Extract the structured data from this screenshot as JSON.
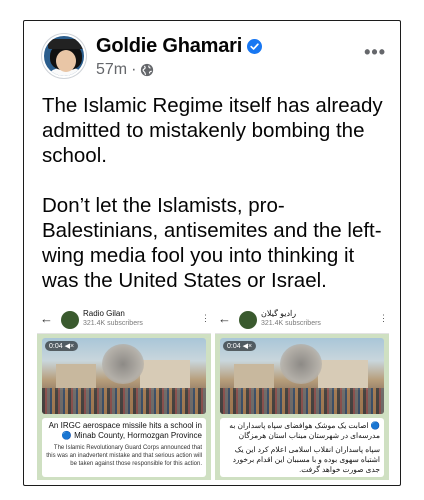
{
  "post": {
    "author_name": "Goldie Ghamari",
    "time": "57m",
    "separator": "·",
    "more_label": "•••",
    "verified_color": "#1877f2",
    "paragraphs": [
      "The Islamic Regime itself has already admitted to mistakenly bombing the school.",
      "Don’t let the Islamists, pro-Balestinians, antisemites and the left-wing media fool you into thinking it was the United States or Israel."
    ]
  },
  "images": [
    {
      "back_icon": "←",
      "channel_name": "Radio Gilan",
      "subscribers": "321.4K subscribers",
      "more_icon": "⋮",
      "video_badge": "0:04 ◀×",
      "caption_main": "An IRGC aerospace missile hits a school in 🔵 Minab County, Hormozgan Province",
      "caption_sub": "The Islamic Revolutionary Guard Corps announced that this was an inadvertent mistake and that serious action will be taken against those responsible for this action."
    },
    {
      "back_icon": "←",
      "channel_name": "رادیو گیلان",
      "subscribers": "321.4K subscribers",
      "more_icon": "⋮",
      "video_badge": "0:04 ◀×",
      "caption_main": "🔵 اصابت یک موشک هوافضای سپاه پاسداران به مدرسه‌ای در شهرستان میناب استان هرمزگان",
      "caption_sub": "سپاه پاسداران انقلاب اسلامی اعلام کرد این یک اشتباه سهوی بوده و با مسببان این اقدام برخورد جدی صورت خواهد گرفت."
    }
  ]
}
